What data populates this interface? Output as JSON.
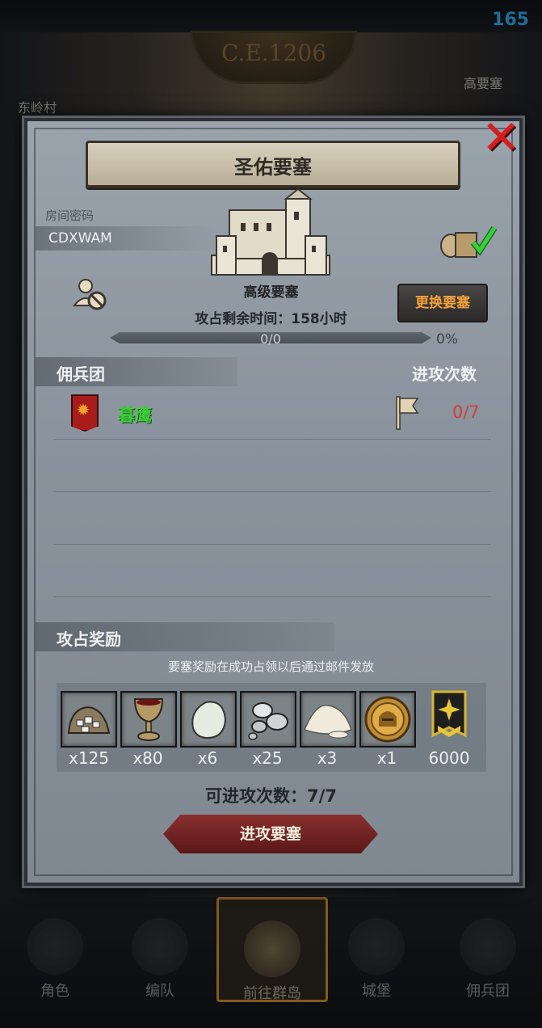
{
  "status": {
    "fps": "165"
  },
  "background": {
    "era": "C.E.1206",
    "village": "东岭村",
    "fortress_label": "高要塞"
  },
  "bottom_nav": [
    {
      "label": "角色",
      "icon": "character-icon"
    },
    {
      "label": "编队",
      "icon": "formation-icon"
    },
    {
      "label": "前往群岛",
      "icon": "archipelago-icon",
      "active": true
    },
    {
      "label": "城堡",
      "icon": "castle-icon"
    },
    {
      "label": "佣兵团",
      "icon": "mercenary-icon"
    }
  ],
  "dialog": {
    "title": "圣佑要塞",
    "room_label": "房间密码",
    "room_code": "CDXWAM",
    "fortress_type": "高级要塞",
    "change_button": "更换要塞",
    "occupy_time": "攻占剩余时间：158小时",
    "progress": {
      "text": "0/0",
      "percent_text": "0%",
      "fraction": 0
    },
    "mercenary_header": "佣兵团",
    "attack_count_header": "进攻次数",
    "mercenaries": [
      {
        "name": "暮鹰",
        "attacks": "0/7"
      }
    ],
    "reward_header": "攻占奖励",
    "reward_note": "要塞奖励在成功占领以后通过邮件发放",
    "rewards": [
      {
        "icon": "ore-sack-icon",
        "qty": "x125"
      },
      {
        "icon": "goblet-icon",
        "qty": "x80"
      },
      {
        "icon": "white-stone-icon",
        "qty": "x6"
      },
      {
        "icon": "silver-ore-icon",
        "qty": "x25"
      },
      {
        "icon": "salt-pile-icon",
        "qty": "x3"
      },
      {
        "icon": "gold-helmet-coin-icon",
        "qty": "x1"
      },
      {
        "icon": "honor-medal-icon",
        "qty": "6000"
      }
    ],
    "remaining_attacks": "可进攻次数：7/7",
    "attack_button": "进攻要塞"
  },
  "colors": {
    "accent_orange": "#f2a23a",
    "merc_green": "#3fcf3c",
    "danger_red": "#d63b3b",
    "fps_blue": "#2ea8e8"
  }
}
